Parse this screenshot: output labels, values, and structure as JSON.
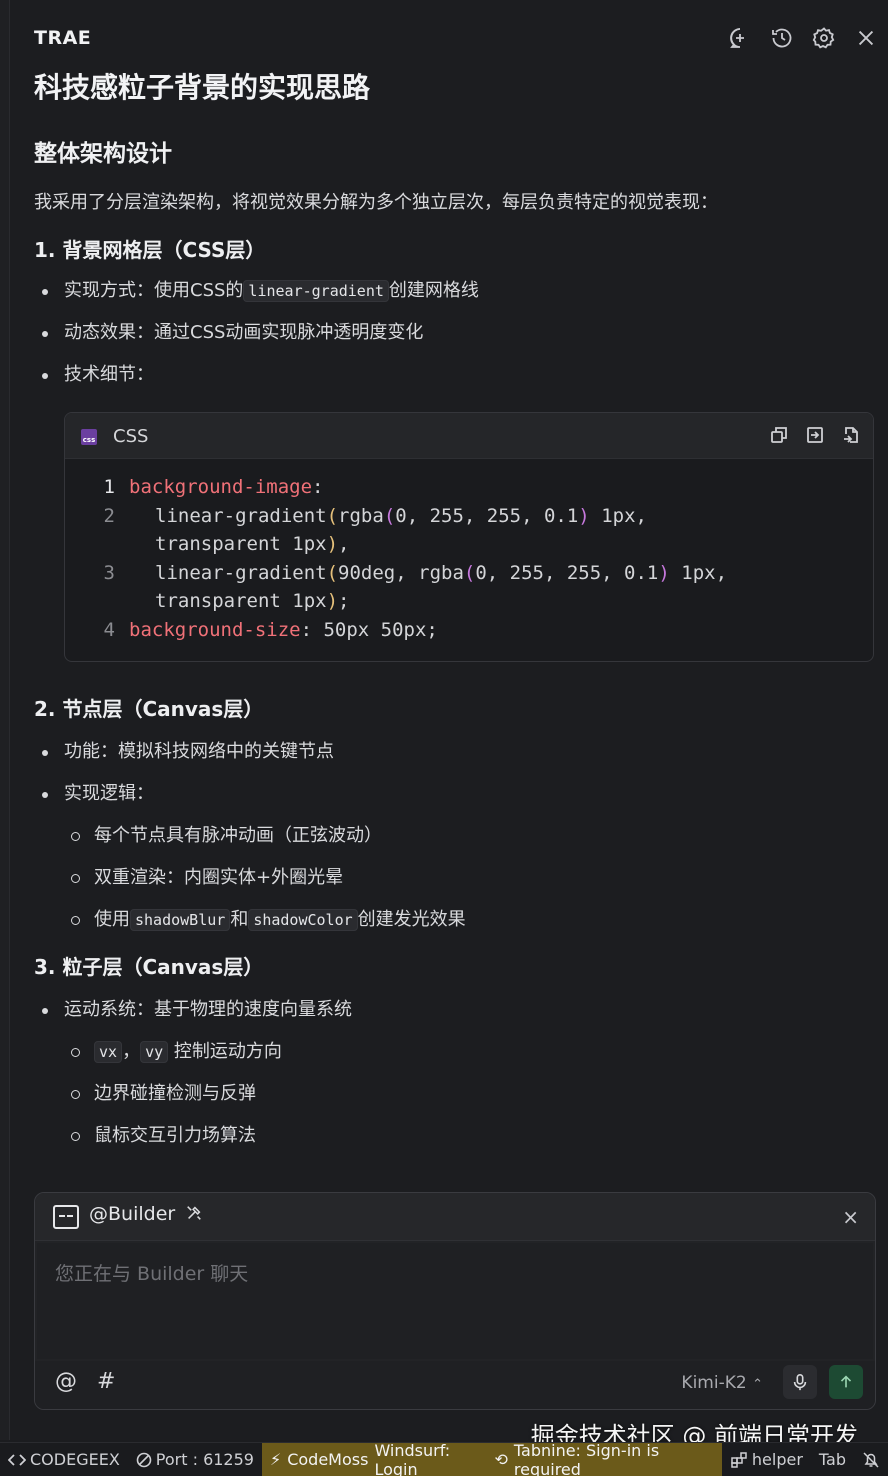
{
  "header": {
    "brand": "TRAE"
  },
  "article": {
    "title": "科技感粒子背景的实现思路",
    "section_title": "整体架构设计",
    "intro": "我采用了分层渲染架构，将视觉效果分解为多个独立层次，每层负责特定的视觉表现：",
    "layer1": {
      "heading": "1. 背景网格层（CSS层）",
      "b1_pre": "实现方式：使用CSS的",
      "b1_code": "linear-gradient",
      "b1_post": "创建网格线",
      "b2": "动态效果：通过CSS动画实现脉冲透明度变化",
      "b3": "技术细节："
    },
    "code": {
      "lang": "CSS",
      "l1_num": "1",
      "l1_prop": "background-image",
      "l1_colon": ":",
      "l2_num": "2",
      "l2_fn": "linear-gradient",
      "l2_lp": "(",
      "l2_inner_fn": "rgba",
      "l2_ilp": "(",
      "l2_args": "0, 255, 255, 0.1",
      "l2_irp": ")",
      "l2_rest": " 1px,",
      "l2b": "transparent 1px",
      "l2b_rp": ")",
      "l2b_end": ",",
      "l3_num": "3",
      "l3_fn": "linear-gradient",
      "l3_lp": "(",
      "l3_pre": "90deg, ",
      "l3_inner_fn": "rgba",
      "l3_ilp": "(",
      "l3_args": "0, 255, 255, 0.1",
      "l3_irp": ")",
      "l3_rest": " 1px,",
      "l3b": "transparent 1px",
      "l3b_rp": ")",
      "l3b_end": ";",
      "l4_num": "4",
      "l4_prop": "background-size",
      "l4_rest": ": 50px 50px;"
    },
    "layer2": {
      "heading": "2. 节点层（Canvas层）",
      "b1": "功能：模拟科技网络中的关键节点",
      "b2": "实现逻辑：",
      "s1": "每个节点具有脉冲动画（正弦波动）",
      "s2": "双重渲染：内圈实体+外圈光晕",
      "s3_pre": "使用",
      "s3_code1": "shadowBlur",
      "s3_mid": "和",
      "s3_code2": "shadowColor",
      "s3_post": "创建发光效果"
    },
    "layer3": {
      "heading": "3. 粒子层（Canvas层）",
      "b1": "运动系统：基于物理的速度向量系统",
      "s1_code1": "vx",
      "s1_sep": "，",
      "s1_code2": "vy",
      "s1_post": "控制运动方向",
      "s2": "边界碰撞检测与反弹",
      "s3": "鼠标交互引力场算法"
    }
  },
  "builder": {
    "name": "@Builder",
    "close": "×",
    "placeholder": "您正在与 Builder 聊天",
    "at": "@",
    "hash": "#",
    "model": "Kimi-K2"
  },
  "watermark": "掘金技术社区 @ 前端日常开发",
  "status": {
    "codegeex": "CODEGEEX",
    "port": "Port : 61259",
    "codemoss": "CodeMoss",
    "windsurf": "Windsurf: Login",
    "tabnine": "Tabnine: Sign-in is required",
    "helper": "helper",
    "tab": "Tab"
  }
}
